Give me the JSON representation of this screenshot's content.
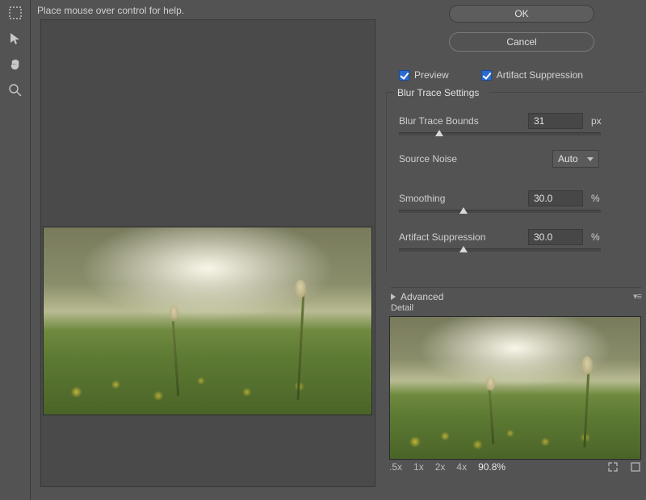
{
  "help_text": "Place mouse over control for help.",
  "buttons": {
    "ok": "OK",
    "cancel": "Cancel"
  },
  "checks": {
    "preview": "Preview",
    "artifact": "Artifact Suppression"
  },
  "group": {
    "title": "Blur Trace Settings"
  },
  "fields": {
    "bounds": {
      "label": "Blur Trace Bounds",
      "value": "31",
      "unit": "px",
      "slider_pct": 18
    },
    "noise": {
      "label": "Source Noise",
      "value": "Auto"
    },
    "smoothing": {
      "label": "Smoothing",
      "value": "30.0",
      "unit": "%",
      "slider_pct": 30
    },
    "suppression": {
      "label": "Artifact Suppression",
      "value": "30.0",
      "unit": "%",
      "slider_pct": 30
    }
  },
  "advanced": {
    "label": "Advanced"
  },
  "detail": {
    "label": "Detail"
  },
  "zoom": {
    "levels": [
      ".5x",
      "1x",
      "2x",
      "4x"
    ],
    "current": "90.8%"
  }
}
